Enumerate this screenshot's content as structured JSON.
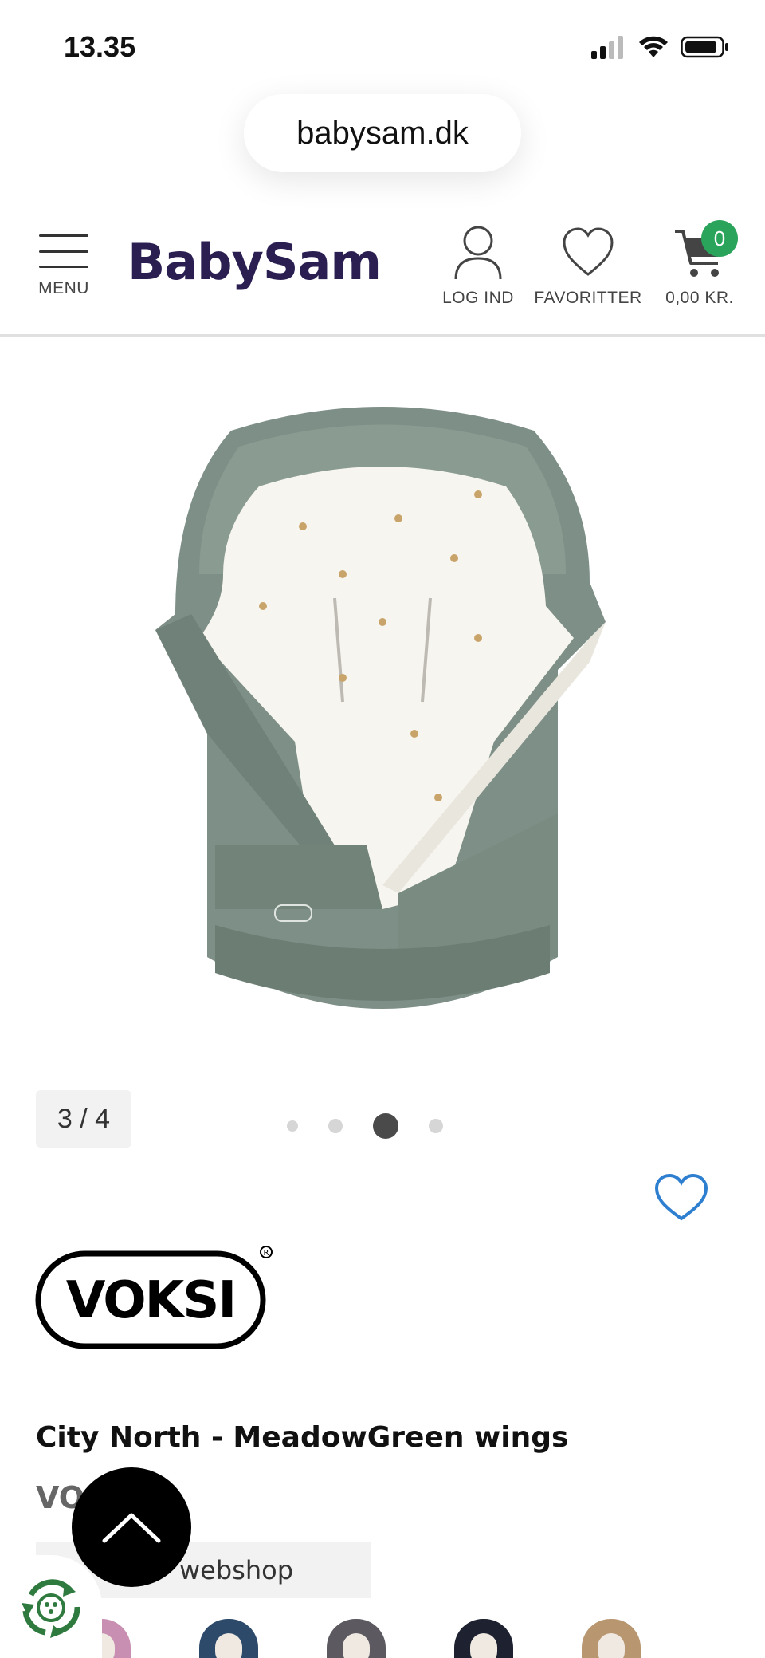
{
  "status_bar": {
    "time": "13.35"
  },
  "browser": {
    "url": "babysam.dk"
  },
  "header": {
    "menu_label": "MENU",
    "logo_text": "BabySam",
    "login_label": "LOG IND",
    "favorites_label": "FAVORITTER",
    "cart_label": "0,00 KR.",
    "cart_count": "0",
    "accent_color": "#2aa35b",
    "logo_color": "#2b1f52"
  },
  "gallery": {
    "counter": "3 / 4",
    "current_index": 3,
    "total": 4
  },
  "product": {
    "brand_logo_text": "VOKSI",
    "title": "City North - MeadowGreen wings",
    "brand": "VOKSI",
    "webshop_text": "webshop",
    "variant_colors": [
      "#c98fb2",
      "#2d4a6b",
      "#5c5a60",
      "#1e2230",
      "#b89670",
      "#ffffff"
    ]
  },
  "icons": {
    "menu": "hamburger-icon",
    "login": "user-icon",
    "favorites": "heart-icon",
    "cart": "cart-icon",
    "scroll_top": "chevron-up-icon",
    "eco": "recycle-icon"
  }
}
